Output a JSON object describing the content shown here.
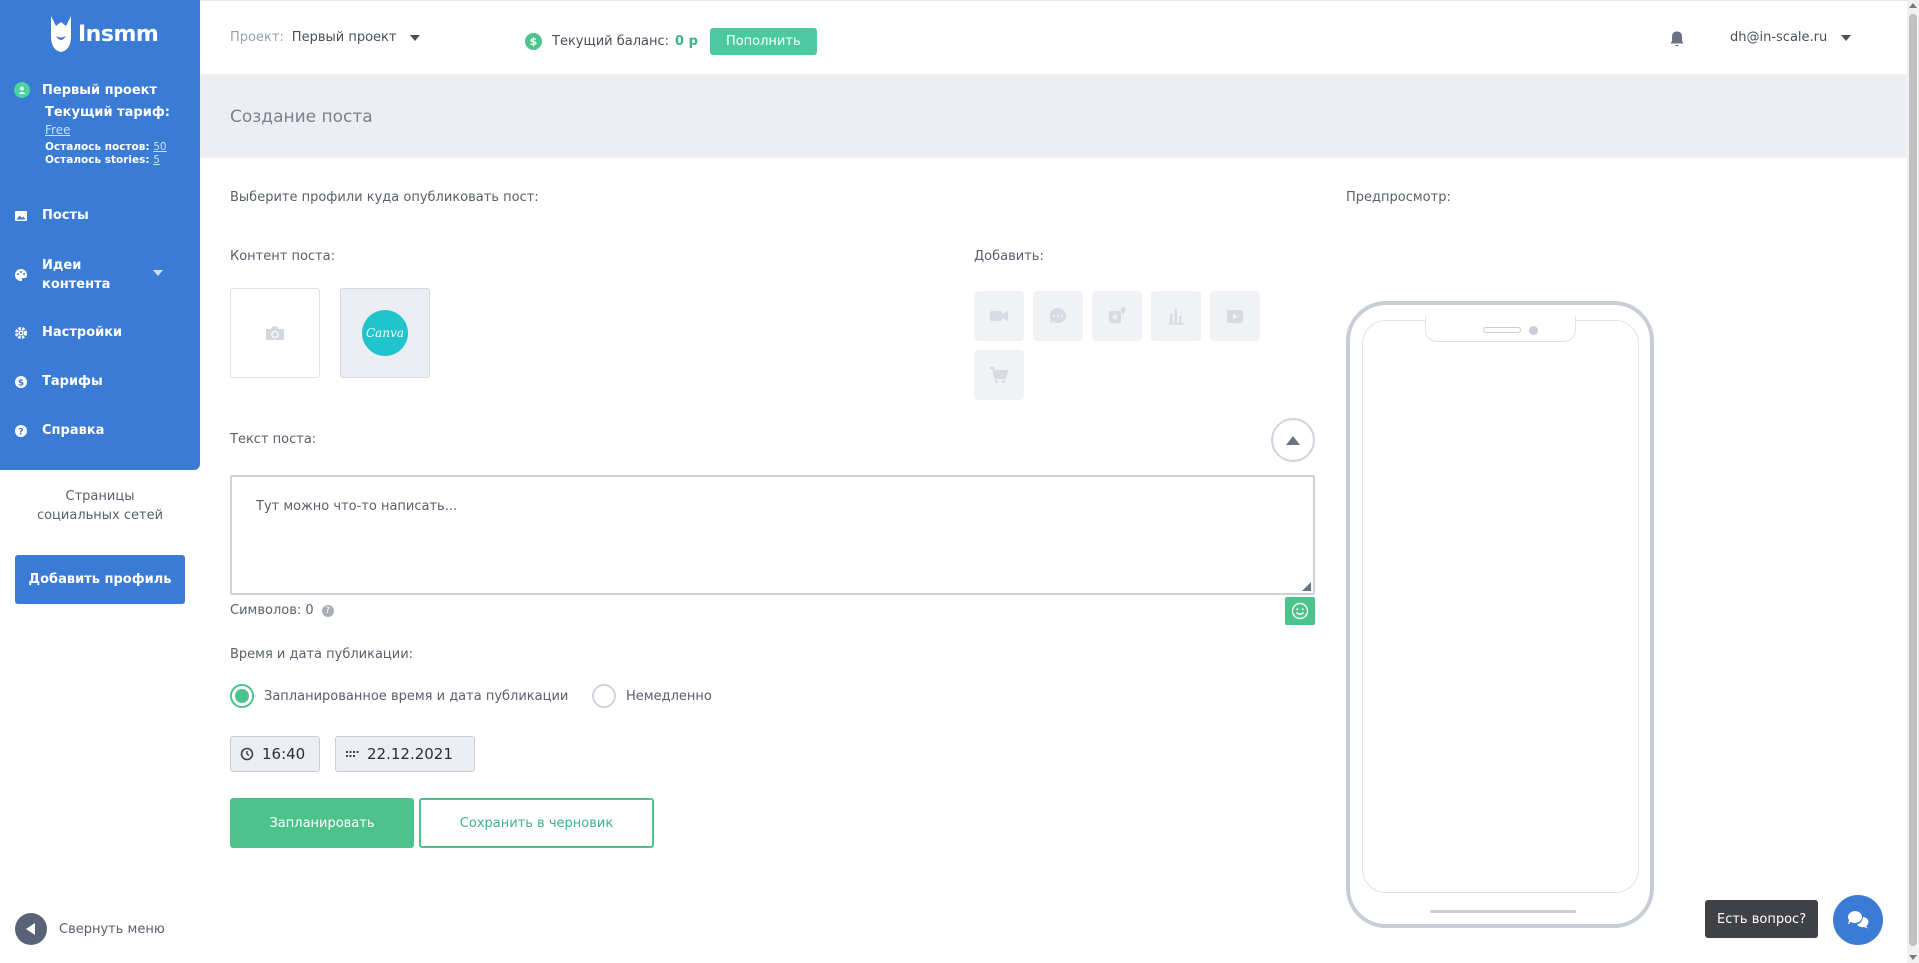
{
  "sidebar": {
    "logo_text": "Insmm",
    "project_name": "Первый проект",
    "tariff_label": "Текущий тариф:",
    "tariff_value": "Free",
    "posts_left_label": "Осталось постов:",
    "posts_left_value": "50",
    "stories_left_label": "Осталось stories:",
    "stories_left_value": "5",
    "items": [
      {
        "label": "Посты",
        "icon": "image-icon"
      },
      {
        "label": "Идеи контента",
        "icon": "palette-icon"
      },
      {
        "label": "Настройки",
        "icon": "gear-icon"
      },
      {
        "label": "Тарифы",
        "icon": "dollar-icon"
      },
      {
        "label": "Справка",
        "icon": "question-icon"
      }
    ],
    "social_pages": "Страницы социальных сетей",
    "add_profile": "Добавить профиль",
    "collapse_menu": "Свернуть меню"
  },
  "header": {
    "project_label": "Проект:",
    "project_value": "Первый проект",
    "balance_label": "Текущий баланс:",
    "balance_value": "0 р",
    "topup": "Пополнить",
    "user_email": "dh@in-scale.ru"
  },
  "page": {
    "title": "Создание поста",
    "choose_profiles": "Выберите профили куда опубликовать пост:",
    "preview": "Предпросмотр:",
    "content_label": "Контент поста:",
    "canva_text": "Canva",
    "add_label": "Добавить:",
    "text_label": "Текст поста:",
    "text_placeholder": "Тут можно что-то написать...",
    "chars_label": "Символов: 0",
    "time_label": "Время и дата публикации:",
    "radio_scheduled": "Запланированное время и дата публикации",
    "radio_now": "Немедленно",
    "time_value": "16:40",
    "date_value": "22.12.2021",
    "schedule_btn": "Запланировать",
    "draft_btn": "Сохранить в черновик"
  },
  "chat": {
    "bubble": "Есть вопрос?"
  },
  "colors": {
    "sidebar": "#3a7bd5",
    "accent_green": "#4cc38a",
    "title_bar": "#eceef3"
  }
}
